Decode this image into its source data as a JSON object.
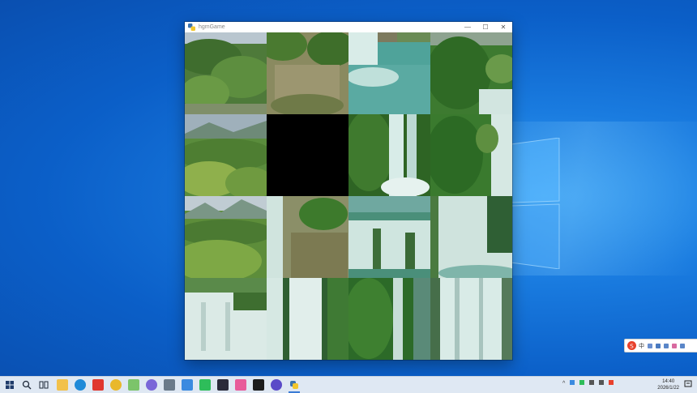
{
  "window": {
    "title": "hgmGame",
    "controls": [
      "—",
      "☐",
      "✕"
    ]
  },
  "puzzle": {
    "grid_size": 4,
    "empty_tile": {
      "row": 1,
      "col": 1
    },
    "tiles": [
      [
        "forest-hill",
        "forest-rocks",
        "waterfall-pool",
        "green-cliff"
      ],
      [
        "mountain-trees",
        "empty",
        "green-waterfall",
        "cliff-waterfall"
      ],
      [
        "mountain-valley",
        "cliff-falls",
        "cascade-top",
        "wide-falls"
      ],
      [
        "wide-falls-base",
        "falls-column",
        "jungle-falls",
        "white-falls"
      ]
    ]
  },
  "ime": {
    "label": "中",
    "icons": [
      "moon-icon",
      "mic-icon",
      "keyboard-icon",
      "skin-icon",
      "grid-icon"
    ]
  },
  "taskbar": {
    "apps": [
      "start-icon",
      "search-icon",
      "taskview-icon",
      "explorer-icon",
      "edge-icon",
      "wps-icon",
      "chrome-icon",
      "notepad-icon",
      "browser-icon",
      "calculator-icon",
      "store-icon",
      "wechat-icon",
      "media-icon",
      "game-icon",
      "terminal-icon",
      "qq-icon",
      "python-icon"
    ],
    "tray_text": "",
    "time": "14:40",
    "date": "2026/1/22"
  },
  "colors": {
    "accent": "#3a7bd5",
    "desktop_blue": "#0b5fc8"
  }
}
